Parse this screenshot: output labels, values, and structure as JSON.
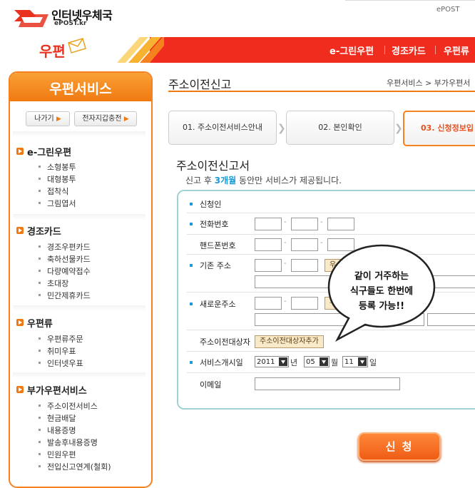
{
  "header": {
    "logo_text": "인터넷우체국",
    "logo_sub": "ePOST.kr",
    "top_link": "ePOST"
  },
  "nav": {
    "logo": "우편",
    "items": [
      "e-그린우편",
      "경조카드",
      "우편류"
    ]
  },
  "sidebar": {
    "title": "우편서비스",
    "buttons": [
      "나가기",
      "전자지갑충전"
    ],
    "sections": [
      {
        "title": "e-그린우편",
        "items": [
          "소형봉투",
          "대형봉투",
          "접착식",
          "그림엽서"
        ]
      },
      {
        "title": "경조카드",
        "items": [
          "경조우편카드",
          "축하선물카드",
          "다량예약접수",
          "초대장",
          "민간제휴카드"
        ]
      },
      {
        "title": "우편류",
        "items": [
          "우편류주문",
          "취미우표",
          "인터넷우표"
        ]
      },
      {
        "title": "부가우편서비스",
        "items": [
          "주소이전서비스",
          "현금배달",
          "내용증명",
          "발송후내용증명",
          "민원우편",
          "전입신고연계(철회)"
        ]
      }
    ]
  },
  "content": {
    "page_title": "주소이전신고",
    "breadcrumb": "우편서비스 > 부가우편서",
    "steps": [
      "01. 주소이전서비스안내",
      "02. 본인확인",
      "03. 신청정보입"
    ],
    "form_title": "주소이전신고서",
    "notice_pre": "신고 후",
    "notice_highlight": "3개월",
    "notice_post": "동안만 서비스가 제공됩니다."
  },
  "form": {
    "labels": {
      "applicant": "신청인",
      "phone": "전화번호",
      "mobile": "핸드폰번호",
      "old_address": "기존 주소",
      "new_address": "새로운주소",
      "target": "주소이전대상자",
      "start_date": "서비스개시일",
      "email": "이메일"
    },
    "address_button": "우",
    "add_target_button": "주소이전대상자추가",
    "date": {
      "year": "2011",
      "year_unit": "년",
      "month": "05",
      "month_unit": "월",
      "day": "11",
      "day_unit": "일"
    }
  },
  "bubble": {
    "line1": "같이 거주하는",
    "line2": "식구들도 한번에",
    "line3": "등록 가능!!"
  },
  "submit_label": "신 청",
  "colors": {
    "brand_red": "#ef2c1e",
    "brand_orange": "#f07a11",
    "accent_blue": "#1a9ad6",
    "form_border": "#9fd3d3"
  }
}
